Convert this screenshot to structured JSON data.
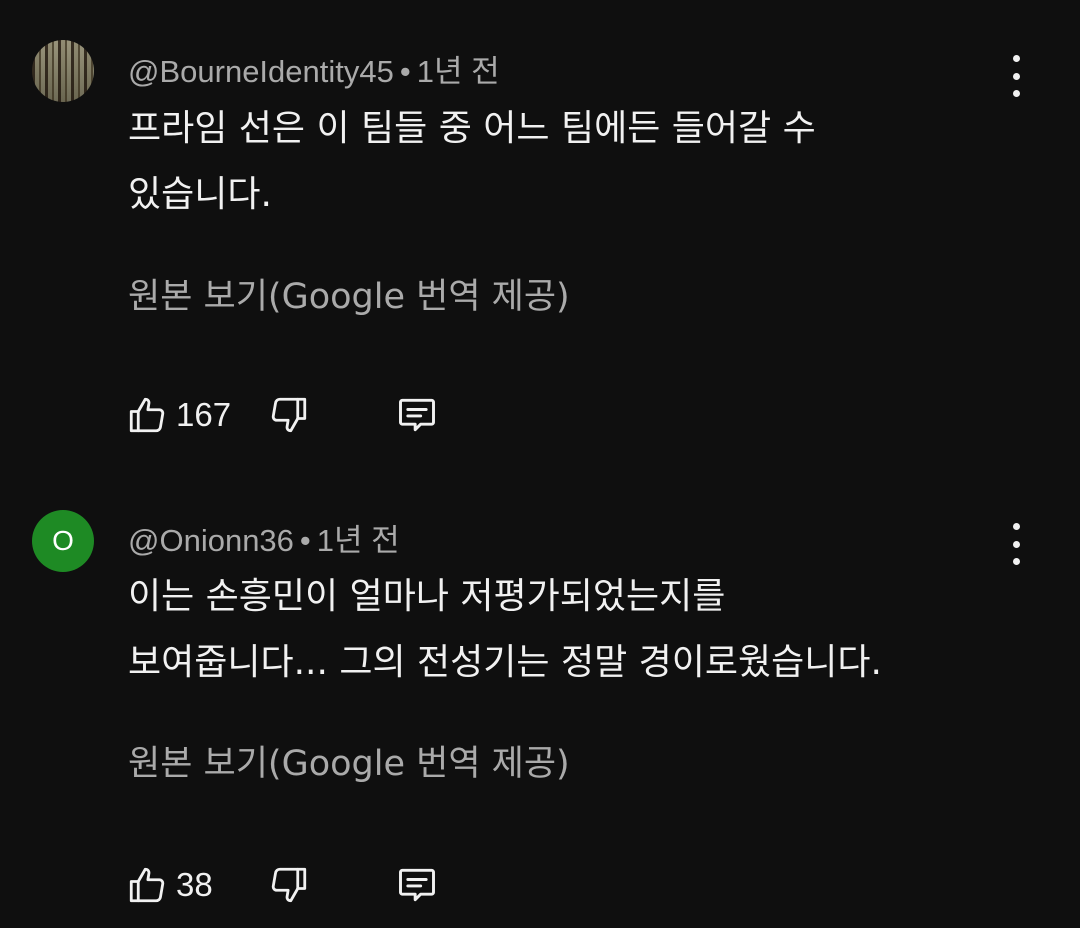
{
  "comments": [
    {
      "author": "@BourneIdentity45",
      "separator": "•",
      "time": "1년 전",
      "text": "프라임 선은 이 팀들 중 어느 팀에든 들어갈 수\n있습니다.",
      "see_original": "원본 보기(Google 번역 제공)",
      "likes": "167",
      "avatar": {
        "type": "image",
        "icon": "forest-avatar"
      }
    },
    {
      "author": "@Onionn36",
      "separator": "•",
      "time": "1년 전",
      "text": "이는 손흥민이 얼마나 저평가되었는지를\n보여줍니다... 그의 전성기는 정말 경이로웠습니다.",
      "see_original": "원본 보기(Google 번역 제공)",
      "likes": "38",
      "avatar": {
        "type": "letter",
        "letter": "O",
        "color": "#1e8a24"
      }
    }
  ],
  "icons": {
    "like": "thumbs-up-icon",
    "dislike": "thumbs-down-icon",
    "reply": "comment-icon",
    "more": "more-vertical-icon"
  },
  "colors": {
    "background": "#0f0f0f",
    "text_primary": "#f1f1f1",
    "text_secondary": "#aaaaaa"
  }
}
